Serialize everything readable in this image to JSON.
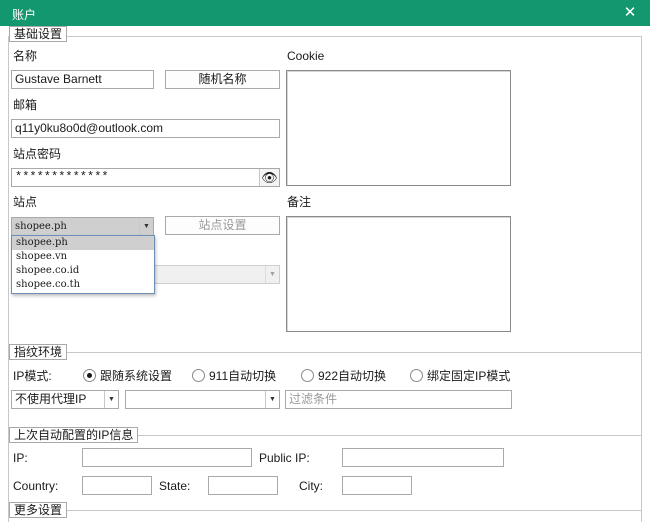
{
  "window": {
    "title": "账户",
    "close_glyph": "✕"
  },
  "basic": {
    "section_title": "基础设置",
    "name_label": "名称",
    "name_value": "Gustave Barnett",
    "random_name_button": "随机名称",
    "cookie_label": "Cookie",
    "email_label": "邮箱",
    "email_value": "q11y0ku8o0d@outlook.com",
    "site_password_label": "站点密码",
    "site_password_value": "*************",
    "site_label": "站点",
    "site_selected": "shopee.ph",
    "site_settings_button": "站点设置",
    "notes_label": "备注",
    "site_options": [
      "shopee.ph",
      "shopee.vn",
      "shopee.co.id",
      "shopee.co.th"
    ]
  },
  "fingerprint": {
    "section_title": "指纹环境",
    "ip_mode_label": "IP模式:",
    "ip_modes": [
      "跟随系统设置",
      "911自动切换",
      "922自动切换",
      "绑定固定IP模式"
    ],
    "selected_mode": 0,
    "proxy_select": "不使用代理IP",
    "second_select": "",
    "filter_placeholder": "过滤条件"
  },
  "last_ip": {
    "section_title": "上次自动配置的IP信息",
    "ip_label": "IP:",
    "public_ip_label": "Public IP:",
    "country_label": "Country:",
    "state_label": "State:",
    "city_label": "City:"
  },
  "more": {
    "section_title": "更多设置"
  },
  "icons": {
    "eye": "👁",
    "dropdown_arrow": "▼"
  }
}
